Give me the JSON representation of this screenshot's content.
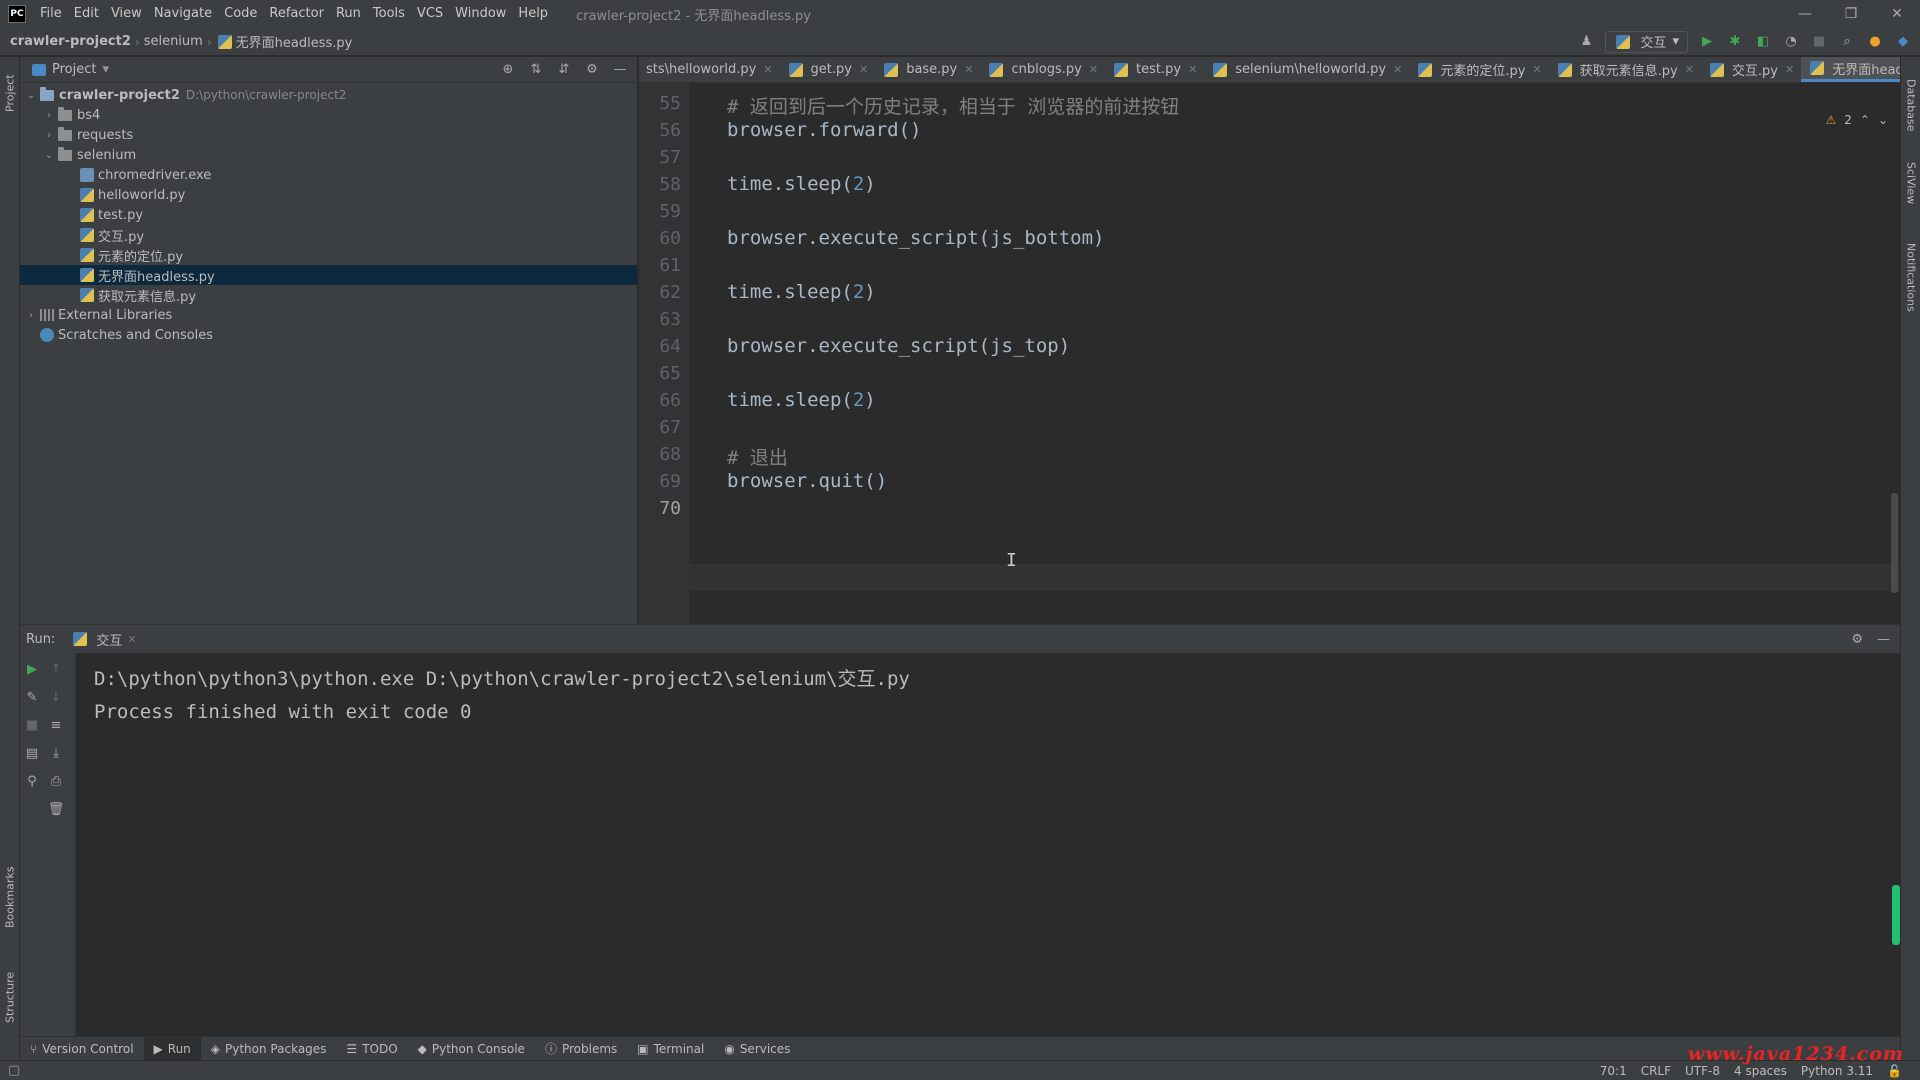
{
  "app": {
    "logo": "PC",
    "window_title": "crawler-project2 - 无界面headless.py",
    "menu": [
      "File",
      "Edit",
      "View",
      "Navigate",
      "Code",
      "Refactor",
      "Run",
      "Tools",
      "VCS",
      "Window",
      "Help"
    ]
  },
  "navbar": {
    "breadcrumb": [
      "crawler-project2",
      "selenium",
      "无界面headless.py"
    ],
    "run_config": "交互"
  },
  "project": {
    "title": "Project",
    "root": {
      "name": "crawler-project2",
      "path": "D:\\python\\crawler-project2"
    },
    "folders": [
      "bs4",
      "requests",
      "selenium"
    ],
    "selenium_files": [
      "chromedriver.exe",
      "helloworld.py",
      "test.py",
      "交互.py",
      "元素的定位.py",
      "无界面headless.py",
      "获取元素信息.py"
    ],
    "selected_file": "无界面headless.py",
    "external_libraries": "External Libraries",
    "scratches": "Scratches and Consoles"
  },
  "editor": {
    "tabs": [
      "sts\\helloworld.py",
      "get.py",
      "base.py",
      "cnblogs.py",
      "test.py",
      "selenium\\helloworld.py",
      "元素的定位.py",
      "获取元素信息.py",
      "交互.py",
      "无界面headless.py"
    ],
    "active_tab": "无界面headless.py",
    "inspection_count": "2",
    "lines": [
      {
        "no": "55",
        "text": "# 返回到后一个历史记录，相当于 浏览器的前进按钮",
        "kind": "comment"
      },
      {
        "no": "56",
        "text": "browser.forward()",
        "kind": "code"
      },
      {
        "no": "57",
        "text": "",
        "kind": "code"
      },
      {
        "no": "58",
        "pre": "time.sleep(",
        "num": "2",
        "post": ")",
        "kind": "num"
      },
      {
        "no": "59",
        "text": "",
        "kind": "code"
      },
      {
        "no": "60",
        "text": "browser.execute_script(js_bottom)",
        "kind": "code"
      },
      {
        "no": "61",
        "text": "",
        "kind": "code"
      },
      {
        "no": "62",
        "pre": "time.sleep(",
        "num": "2",
        "post": ")",
        "kind": "num"
      },
      {
        "no": "63",
        "text": "",
        "kind": "code"
      },
      {
        "no": "64",
        "text": "browser.execute_script(js_top)",
        "kind": "code"
      },
      {
        "no": "65",
        "text": "",
        "kind": "code"
      },
      {
        "no": "66",
        "pre": "time.sleep(",
        "num": "2",
        "post": ")",
        "kind": "num"
      },
      {
        "no": "67",
        "text": "",
        "kind": "code"
      },
      {
        "no": "68",
        "text": "# 退出",
        "kind": "comment"
      },
      {
        "no": "69",
        "text": "browser.quit()",
        "kind": "code"
      },
      {
        "no": "70",
        "text": "",
        "kind": "code"
      }
    ],
    "current_line": "70"
  },
  "run": {
    "label": "Run:",
    "tab": "交互",
    "console": [
      "D:\\python\\python3\\python.exe D:\\python\\crawler-project2\\selenium\\交互.py",
      "",
      "Process finished with exit code 0"
    ]
  },
  "bottom_tabs": [
    "Version Control",
    "Run",
    "Python Packages",
    "TODO",
    "Python Console",
    "Problems",
    "Terminal",
    "Services"
  ],
  "active_bottom_tab": "Run",
  "left_tool_tabs": [
    "Project",
    "Bookmarks",
    "Structure"
  ],
  "right_tool_tabs": [
    "Database",
    "SciView",
    "Notifications"
  ],
  "status": {
    "position": "70:1",
    "line_sep": "CRLF",
    "encoding": "UTF-8",
    "indent": "4 spaces",
    "interpreter": "Python 3.11"
  },
  "watermark": "www.java1234.com",
  "colors": {
    "bg": "#2b2b2b",
    "panel": "#3c3f41",
    "accent": "#4a88c7",
    "number": "#6897bb",
    "comment": "#808080",
    "run_green": "#3ea852"
  },
  "icons": [
    "app-logo-icon",
    "run-icon",
    "debug-icon",
    "coverage-icon",
    "profile-icon",
    "stop-icon",
    "search-icon",
    "update-icon",
    "gear-icon",
    "minimize-icon",
    "folder-icon",
    "python-file-icon"
  ]
}
